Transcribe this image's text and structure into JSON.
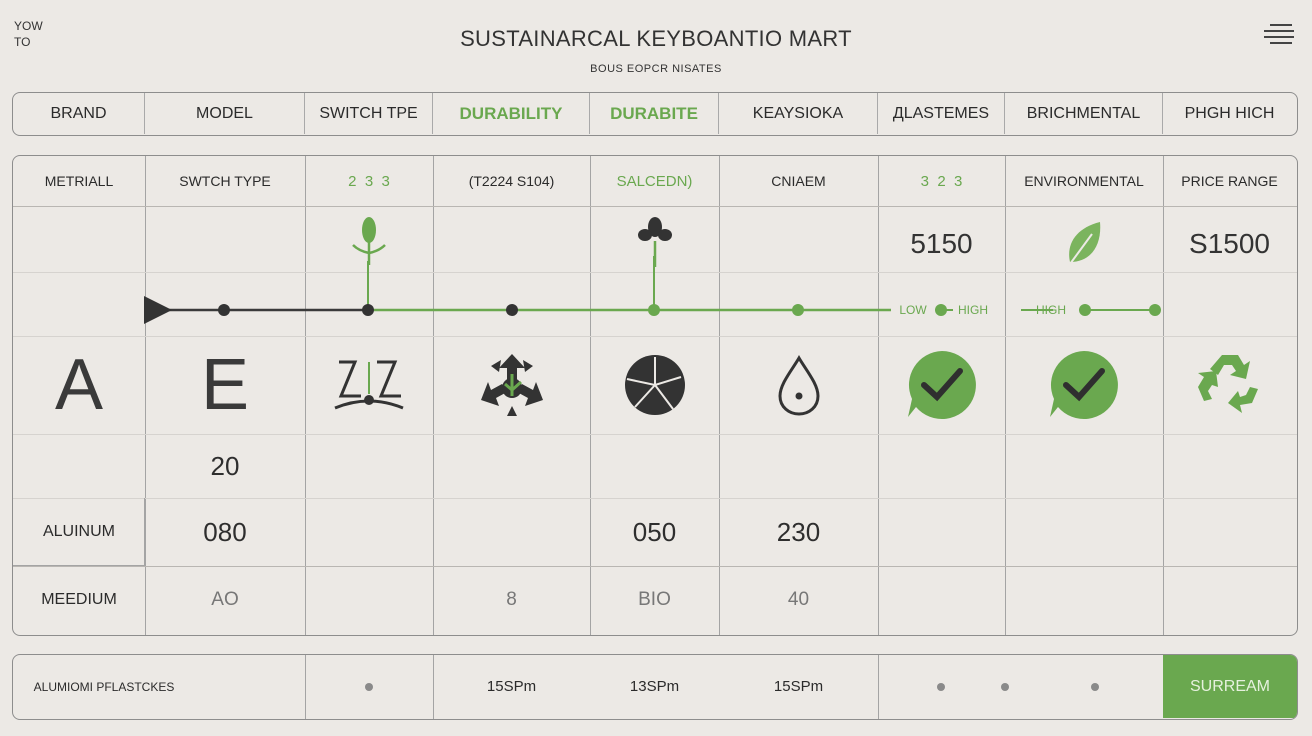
{
  "colors": {
    "accent": "#6aa84f",
    "text": "#2b2b2b",
    "background": "#ece9e5",
    "border": "#8d8d8d"
  },
  "header": {
    "topleft_line1": "YOW",
    "topleft_line2": "TO",
    "title": "SUSTAINARCAL KEYBOANTIO MART",
    "subtitle": "BOUS EOPCR NISATES",
    "menu_icon": "hamburger-menu-icon"
  },
  "columns": [
    "BRAND",
    "MODEL",
    "SWITCH TPE",
    "DURABILITY",
    "DURABITE",
    "KEAYSIOKA",
    "ДLASTEMES",
    "BRICHMENTAL",
    "PHGH HICH"
  ],
  "subheaders": [
    "METRIALL",
    "SWTCH TYPE",
    "2  3  3",
    "(T2224 S104)",
    "SALCEDN)",
    "CNIAEM",
    "3  2  3",
    "ENVIRONMENTAL",
    "PRICE RANGE"
  ],
  "row_values": {
    "price_1": "5150",
    "price_2": "S1500"
  },
  "timeline": {
    "low": "LOW",
    "high_1": "HIGH",
    "high_2": "HIGH"
  },
  "letters": [
    "A",
    "E"
  ],
  "icons": {
    "arrow": "arrow-head-icon",
    "sprout": "sprout-icon",
    "leaf_cluster": "leaf-cluster-icon",
    "leaf": "leaf-icon",
    "switch": "switch-shape-icon",
    "recycle_dark": "recycle-icon",
    "disc": "segmented-disc-icon",
    "drop": "drop-icon",
    "check_1": "checkmark-icon",
    "check_2": "checkmark-icon",
    "recycle_green": "recycle-icon"
  },
  "rows": {
    "model_count": "20",
    "material_label": "ALUINUM",
    "material_values": [
      "080",
      "050",
      "230"
    ],
    "grade_label": "MEEDIUM",
    "grade_values": [
      "AO",
      "8",
      "BIO",
      "40"
    ]
  },
  "footer": {
    "label": "ALUMIOMI PFLASTCKES",
    "times": [
      "15SPm",
      "13SPm",
      "15SPm"
    ],
    "submit_label": "SURREAM"
  }
}
